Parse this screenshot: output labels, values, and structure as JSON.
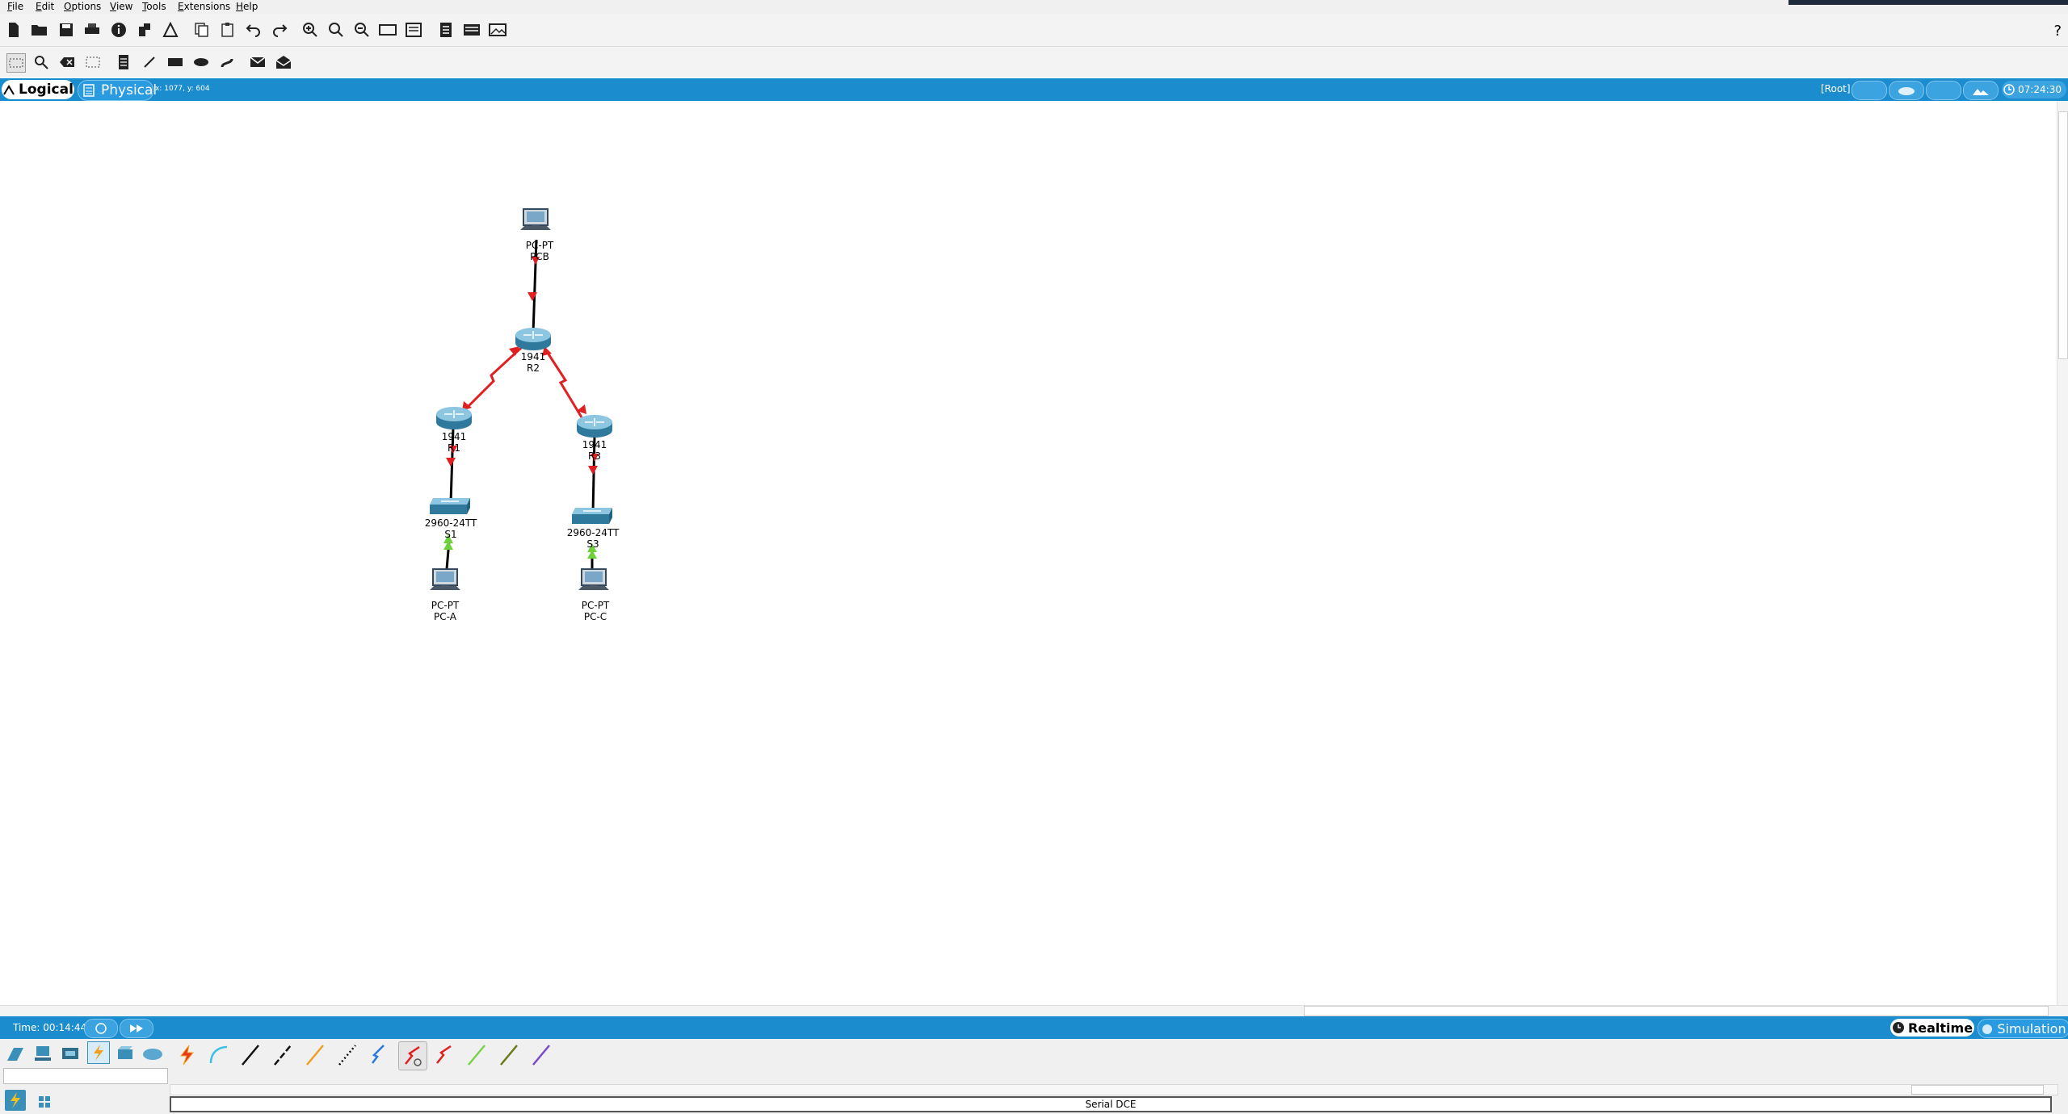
{
  "menu": [
    "File",
    "Edit",
    "Options",
    "View",
    "Tools",
    "Extensions",
    "Help"
  ],
  "help_mark": "?",
  "toolbar1_icons": [
    "new-file-icon",
    "open-folder-icon",
    "save-icon",
    "print-icon",
    "info-icon",
    "network-wizard-icon",
    "activity-wizard-icon",
    "copy-icon",
    "paste-icon",
    "undo-icon",
    "redo-icon",
    "zoom-in-icon",
    "zoom-reset-icon",
    "zoom-out-icon",
    "drawing-palette-icon",
    "custom-device-dialog-icon",
    "view-command-log-icon",
    "pdu-list-icon",
    "screenshot-icon"
  ],
  "toolbar2_icons": [
    "select-icon",
    "inspect-icon",
    "delete-icon",
    "resize-shape-icon",
    "place-note-icon",
    "draw-line-icon",
    "draw-rectangle-icon",
    "draw-ellipse-icon",
    "freeform-icon",
    "add-simple-pdu-icon",
    "add-complex-pdu-icon"
  ],
  "tabs": {
    "logical": "Logical",
    "physical": "Physical"
  },
  "cursor_coords": "x: 1077, y: 604",
  "root_label": "[Root]",
  "clock": "07:24:30",
  "devices": [
    {
      "model": "PC-PT",
      "name": "PCB"
    },
    {
      "model": "1941",
      "name": "R2"
    },
    {
      "model": "1941",
      "name": "R1"
    },
    {
      "model": "1941",
      "name": "R3"
    },
    {
      "model": "2960-24TT",
      "name": "S1"
    },
    {
      "model": "2960-24TT",
      "name": "S3"
    },
    {
      "model": "PC-PT",
      "name": "PC-A"
    },
    {
      "model": "PC-PT",
      "name": "PC-C"
    }
  ],
  "link_colors": {
    "down": "#e02020",
    "up": "#6fd13a",
    "cable": "#000000"
  },
  "time_text": "Time: 00:14:44",
  "mode": {
    "realtime": "Realtime",
    "simulation": "Simulation"
  },
  "device_categories": [
    "network-devices-icon",
    "end-devices-icon",
    "components-icon",
    "connections-icon",
    "miscellaneous-icon",
    "multiuser-icon"
  ],
  "cables": [
    "automatic-cable-icon",
    "console-cable-icon",
    "copper-straight-through-icon",
    "copper-cross-over-icon",
    "fiber-icon",
    "phone-cable-icon",
    "coaxial-cable-icon",
    "serial-dce-icon",
    "serial-dte-icon",
    "octal-cable-icon",
    "iot-custom-cable-icon",
    "usb-cable-icon"
  ],
  "status_text": "Serial DCE",
  "accent_color": "#1b8ccd"
}
